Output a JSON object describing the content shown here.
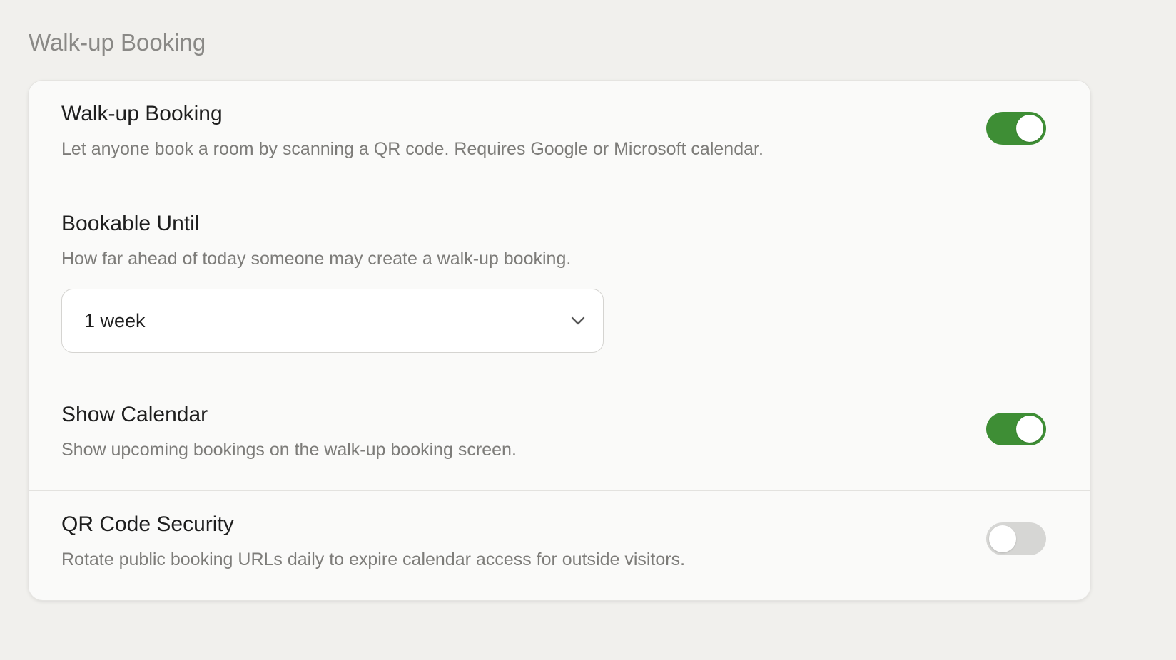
{
  "page": {
    "title": "Walk-up Booking"
  },
  "settings": [
    {
      "title": "Walk-up Booking",
      "description": "Let anyone book a room by scanning a QR code. Requires Google or Microsoft calendar.",
      "toggle": "on"
    },
    {
      "title": "Bookable Until",
      "description": "How far ahead of today someone may create a walk-up booking.",
      "select_value": "1 week"
    },
    {
      "title": "Show Calendar",
      "description": "Show upcoming bookings on the walk-up booking screen.",
      "toggle": "on"
    },
    {
      "title": "QR Code Security",
      "description": "Rotate public booking URLs daily to expire calendar access for outside visitors.",
      "toggle": "off"
    }
  ],
  "colors": {
    "toggle_on": "#3e8e35",
    "toggle_off": "#d6d6d4",
    "background": "#f1f0ed",
    "card": "#fafaf9"
  },
  "icons": {
    "select_chevron": "chevron-down-icon"
  }
}
